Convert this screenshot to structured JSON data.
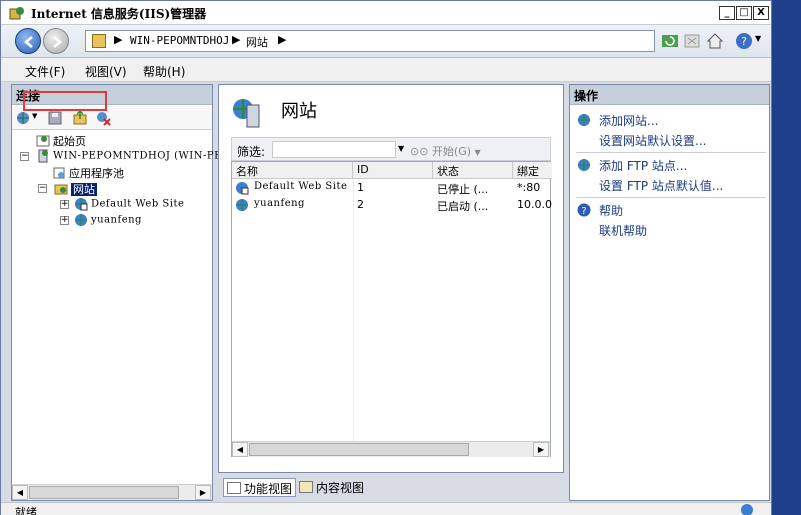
{
  "window": {
    "title": "Internet 信息服务(IIS)管理器",
    "minimize": "_",
    "maximize": "□",
    "close": "X"
  },
  "address": {
    "crumbs": [
      "WIN-PEPOMNTDHOJ",
      "网站"
    ],
    "separator": "▶"
  },
  "menu": [
    "文件(F)",
    "视图(V)",
    "帮助(H)"
  ],
  "connections": {
    "header": "连接",
    "tree": {
      "start_page": "起始页",
      "server": "WIN-PEPOMNTDHOJ (WIN-PEPOM",
      "app_pools": "应用程序池",
      "sites": "网站",
      "site1": "Default Web Site",
      "site2": "yuanfeng"
    }
  },
  "main": {
    "title": "网站",
    "filter_label": "筛选:",
    "start_label": "开始(G)",
    "columns": [
      "名称",
      "ID",
      "状态",
      "绑定"
    ],
    "rows": [
      {
        "name": "Default Web Site",
        "id": "1",
        "status": "已停止 (...",
        "binding": "*:80"
      },
      {
        "name": "yuanfeng",
        "id": "2",
        "status": "已启动 (...",
        "binding": "10.0.0"
      }
    ],
    "views": {
      "features": "功能视图",
      "content": "内容视图"
    }
  },
  "actions": {
    "header": "操作",
    "add_site": "添加网站...",
    "site_defaults": "设置网站默认设置...",
    "add_ftp": "添加 FTP 站点...",
    "ftp_defaults": "设置 FTP 站点默认值...",
    "help": "帮助",
    "online_help": "联机帮助"
  },
  "status": {
    "text": "就绪"
  },
  "colors": {
    "desktop": "#1e3f8a",
    "selection": "#0a246a",
    "highlight_box": "#e03a3a",
    "link": "#1c3a82"
  }
}
